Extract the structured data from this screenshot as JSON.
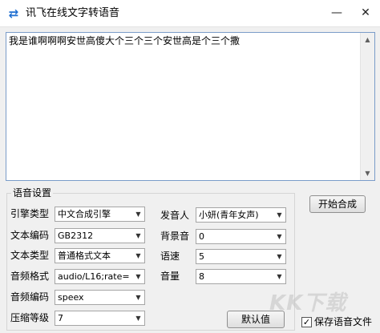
{
  "window": {
    "title": "讯飞在线文字转语音",
    "icon": "swap-arrows-icon",
    "accent": "#1f6fd1"
  },
  "editor": {
    "text": "我是谁啊啊啊安世高傻大个三个三个安世高是个三个撒"
  },
  "voice_settings": {
    "group_title": "语音设置",
    "engine": {
      "label": "引擎类型",
      "value": "中文合成引擎"
    },
    "encoding": {
      "label": "文本编码",
      "value": "GB2312"
    },
    "text_type": {
      "label": "文本类型",
      "value": "普通格式文本"
    },
    "audio_format": {
      "label": "音频格式",
      "value": "audio/L16;rate="
    },
    "audio_codec": {
      "label": "音频编码",
      "value": "speex"
    },
    "compression": {
      "label": "压缩等级",
      "value": "7"
    },
    "speaker": {
      "label": "发音人",
      "value": "小妍(青年女声)"
    },
    "bg_sound": {
      "label": "背景音",
      "value": "0"
    },
    "speed": {
      "label": "语速",
      "value": "5"
    },
    "volume": {
      "label": "音量",
      "value": "8"
    }
  },
  "buttons": {
    "start": "开始合成",
    "default": "默认值"
  },
  "save_audio": {
    "label": "保存语音文件",
    "checked": true
  },
  "watermark": "KK下载"
}
